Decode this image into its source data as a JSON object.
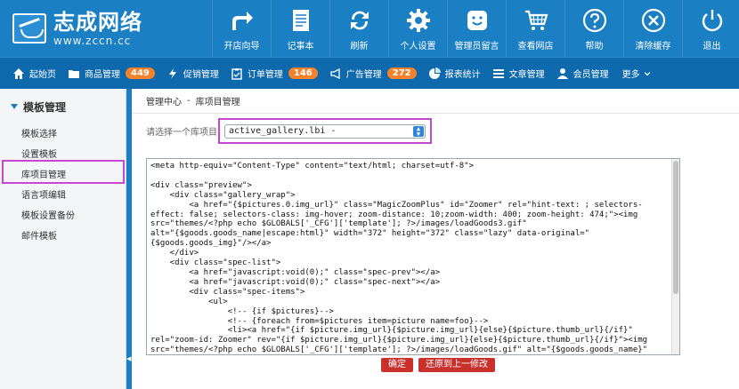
{
  "brand": {
    "name": "志成网络",
    "url": "www.zccn.cc"
  },
  "topnav": [
    {
      "label": "开店向导",
      "icon": "share-arrow-icon"
    },
    {
      "label": "记事本",
      "icon": "notepad-icon"
    },
    {
      "label": "刷新",
      "icon": "refresh-icon"
    },
    {
      "label": "个人设置",
      "icon": "gear-icon"
    },
    {
      "label": "管理员留言",
      "icon": "chat-smile-icon"
    },
    {
      "label": "查看网店",
      "icon": "cart-icon"
    },
    {
      "label": "帮助",
      "icon": "help-icon"
    },
    {
      "label": "清除缓存",
      "icon": "clear-icon"
    },
    {
      "label": "退出",
      "icon": "power-icon"
    }
  ],
  "mainnav": [
    {
      "label": "起始页",
      "icon": "home-icon"
    },
    {
      "label": "商品管理",
      "icon": "folder-icon",
      "badge": "449"
    },
    {
      "label": "促销管理",
      "icon": "lightning-icon"
    },
    {
      "label": "订单管理",
      "icon": "clipboard-icon",
      "badge": "146"
    },
    {
      "label": "广告管理",
      "icon": "megaphone-icon",
      "badge": "272"
    },
    {
      "label": "报表统计",
      "icon": "chart-icon"
    },
    {
      "label": "文章管理",
      "icon": "list-icon"
    },
    {
      "label": "会员管理",
      "icon": "user-icon"
    },
    {
      "label": "更多",
      "icon": "chevron-down-icon"
    }
  ],
  "sidebar": {
    "title": "模板管理",
    "items": [
      "模板选择",
      "设置模板",
      "库项目管理",
      "语言项编辑",
      "模板设置备份",
      "邮件模板"
    ]
  },
  "breadcrumb": {
    "root": "管理中心",
    "sep": "-",
    "current": "库项目管理"
  },
  "library": {
    "label": "请选择一个库项目：",
    "selected": "active_gallery.lbi -",
    "code": "<meta http-equiv=\"Content-Type\" content=\"text/html; charset=utf-8\">\n\n<div class=\"preview\">\n    <div class=\"gallery_wrap\">\n        <a href=\"{$pictures.0.img_url}\" class=\"MagicZoomPlus\" id=\"Zoomer\" rel=\"hint-text: ; selectors-\neffect: false; selectors-class: img-hover; zoom-distance: 10;zoom-width: 400; zoom-height: 474;\"><img\nsrc=\"themes/<?php echo $GLOBALS['_CFG']['template']; ?>/images/loadGoods3.gif\"\nalt=\"{$goods.goods_name|escape:html}\" width=\"372\" height=\"372\" class=\"lazy\" data-original=\"\n{$goods.goods_img}\"/></a>\n    </div>\n    <div class=\"spec-list\">\n        <a href=\"javascript:void(0);\" class=\"spec-prev\"></a>\n        <a href=\"javascript:void(0);\" class=\"spec-next\"></a>\n        <div class=\"spec-items\">\n            <ul>\n                <!-- {if $pictures}-->\n                <!-- {foreach from=$pictures item=picture name=foo}-->\n                <li><a href=\"{if $picture.img_url}{$picture.img_url}{else}{$picture.thumb_url}{/if}\"\nrel=\"zoom-id: Zoomer\" rev=\"{if $picture.img_url}{$picture.img_url}{else}{$picture.thumb_url}{/if}\"><img\nsrc=\"themes/<?php echo $GLOBALS['_CFG']['template']; ?>/images/loadGoods.gif\" alt=\"{$goods.goods_name}\"",
    "confirm_label": "确定",
    "restore_label": "还原到上一修改"
  },
  "colors": {
    "header": "#1b7fc4",
    "nav": "#0e6aad",
    "badge": "#f5822a",
    "highlight": "#c548d2",
    "button": "#c9302c"
  }
}
